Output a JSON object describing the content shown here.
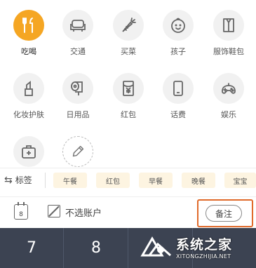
{
  "categories": [
    {
      "label": "吃喝",
      "icon": "fork-knife-icon"
    },
    {
      "label": "交通",
      "icon": "car-seat-icon"
    },
    {
      "label": "买菜",
      "icon": "carrot-icon"
    },
    {
      "label": "孩子",
      "icon": "baby-face-icon"
    },
    {
      "label": "服饰鞋包",
      "icon": "clothes-icon"
    },
    {
      "label": "化妆护肤",
      "icon": "lipstick-icon"
    },
    {
      "label": "日用品",
      "icon": "tissue-roll-icon"
    },
    {
      "label": "红包",
      "icon": "red-envelope-icon"
    },
    {
      "label": "话费",
      "icon": "phone-icon"
    },
    {
      "label": "娱乐",
      "icon": "gamepad-icon"
    },
    {
      "label": "",
      "icon": "medical-kit-icon"
    },
    {
      "label": "",
      "icon": "edit-pencil-icon"
    }
  ],
  "tags": {
    "label": "标签",
    "items": [
      "午餐",
      "红包",
      "早餐",
      "晚餐",
      "宝宝"
    ]
  },
  "note_row": {
    "date_day": "8",
    "account_label": "不选账户",
    "note_button": "备注"
  },
  "keypad": {
    "keys": [
      "7",
      "8"
    ]
  },
  "watermark": {
    "cn": "系统之家",
    "en": "XITONGZHIJIA.NET"
  },
  "colors": {
    "accent": "#f5a623",
    "keypad_bg": "#3c4352",
    "highlight_box": "#e06a2a",
    "chip_bg": "#fdf4e1"
  }
}
